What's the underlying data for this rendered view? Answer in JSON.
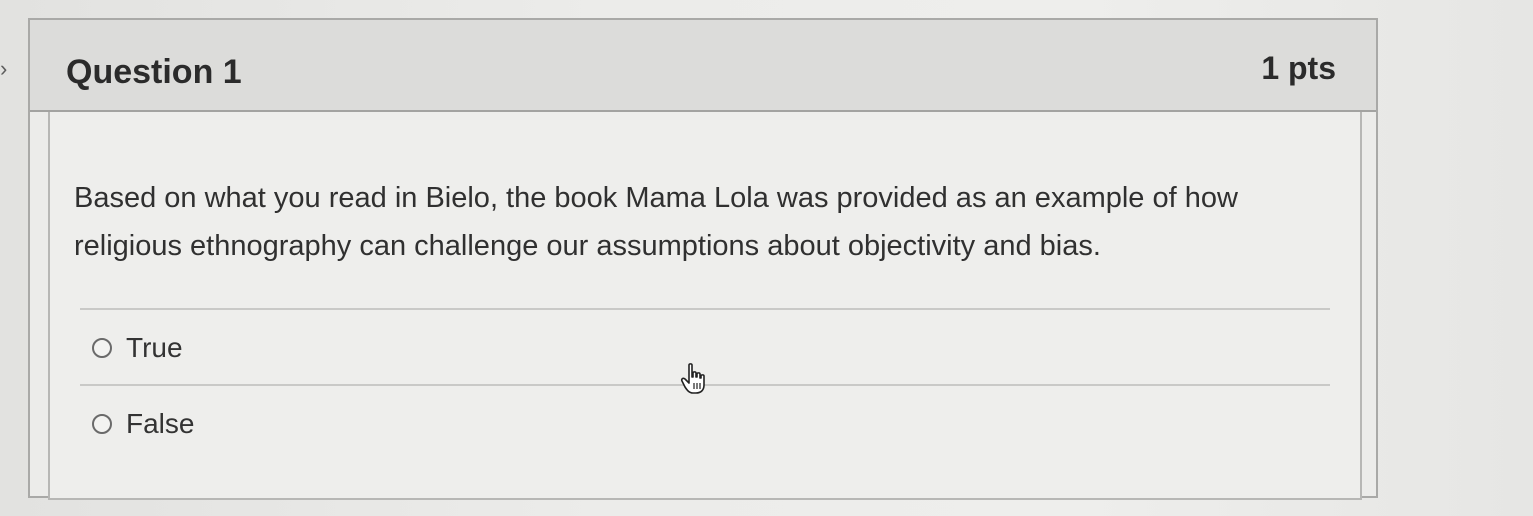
{
  "question": {
    "title": "Question 1",
    "points": "1 pts",
    "text": "Based on what you read in Bielo, the book Mama Lola was provided as an example of how religious ethnography can challenge our assumptions about objectivity and bias.",
    "answers": [
      {
        "label": "True",
        "selected": false
      },
      {
        "label": "False",
        "selected": false
      }
    ]
  },
  "icons": {
    "collapse": "chevron-right-icon",
    "cursor": "hand-pointer-icon"
  },
  "colors": {
    "header_bg": "#dcdcda",
    "card_bg": "#ececea",
    "border": "#a9a9a7",
    "text": "#2b2b2b"
  }
}
